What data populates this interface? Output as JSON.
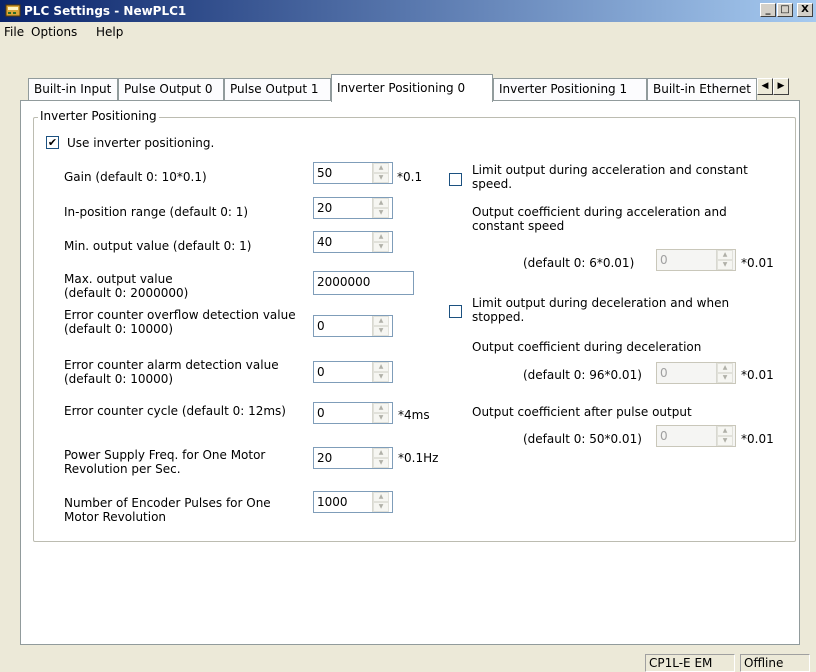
{
  "window": {
    "title": "PLC Settings - NewPLC1",
    "minimize": "_",
    "maximize": "□",
    "close": "X"
  },
  "menu": [
    "File",
    "Options",
    "Help"
  ],
  "tabs": [
    "Built-in Input",
    "Pulse Output 0",
    "Pulse Output 1",
    "Inverter Positioning 0",
    "Inverter Positioning 1",
    "Built-in Ethernet"
  ],
  "active_tab": "Inverter Positioning 0",
  "tab_scroll": {
    "left": "◀",
    "right": "▶"
  },
  "group": {
    "title": "Inverter Positioning",
    "use_checkbox": {
      "label": "Use inverter positioning.",
      "checked": "✔"
    },
    "fields": [
      {
        "label": "Gain (default 0: 10*0.1)",
        "value": "50",
        "unit": "*0.1"
      },
      {
        "label": "In-position range (default 0: 1)",
        "value": "20",
        "unit": ""
      },
      {
        "label": "Min. output value (default 0: 1)",
        "value": "40",
        "unit": ""
      },
      {
        "label": "Max. output value\n(default 0: 2000000)",
        "value": "2000000",
        "unit": ""
      },
      {
        "label": "Error counter overflow detection value\n(default 0: 10000)",
        "value": "0",
        "unit": ""
      },
      {
        "label": "Error counter alarm detection value\n(default 0: 10000)",
        "value": "0",
        "unit": ""
      },
      {
        "label": "Error counter cycle (default 0: 12ms)",
        "value": "0",
        "unit": "*4ms"
      },
      {
        "label": "Power Supply Freq. for One Motor\nRevolution per Sec.",
        "value": "20",
        "unit": "*0.1Hz"
      },
      {
        "label": "Number of Encoder Pulses for One\nMotor Revolution",
        "value": "1000",
        "unit": ""
      }
    ],
    "right": {
      "limit_accel": {
        "label": "Limit output during acceleration and constant\nspeed."
      },
      "accel_coef_title": "Output coefficient during acceleration and\nconstant speed",
      "accel_coef": {
        "label": "(default 0: 6*0.01)",
        "value": "0",
        "unit": "*0.01"
      },
      "limit_decel": {
        "label": "Limit output during deceleration and when\nstopped."
      },
      "decel_coef_title": "Output coefficient during deceleration",
      "decel_coef": {
        "label": "(default 0: 96*0.01)",
        "value": "0",
        "unit": "*0.01"
      },
      "after_title": "Output coefficient after pulse output",
      "after_coef": {
        "label": "(default 0: 50*0.01)",
        "value": "0",
        "unit": "*0.01"
      }
    }
  },
  "status": {
    "device": "CP1L-E EM",
    "mode": "Offline"
  }
}
